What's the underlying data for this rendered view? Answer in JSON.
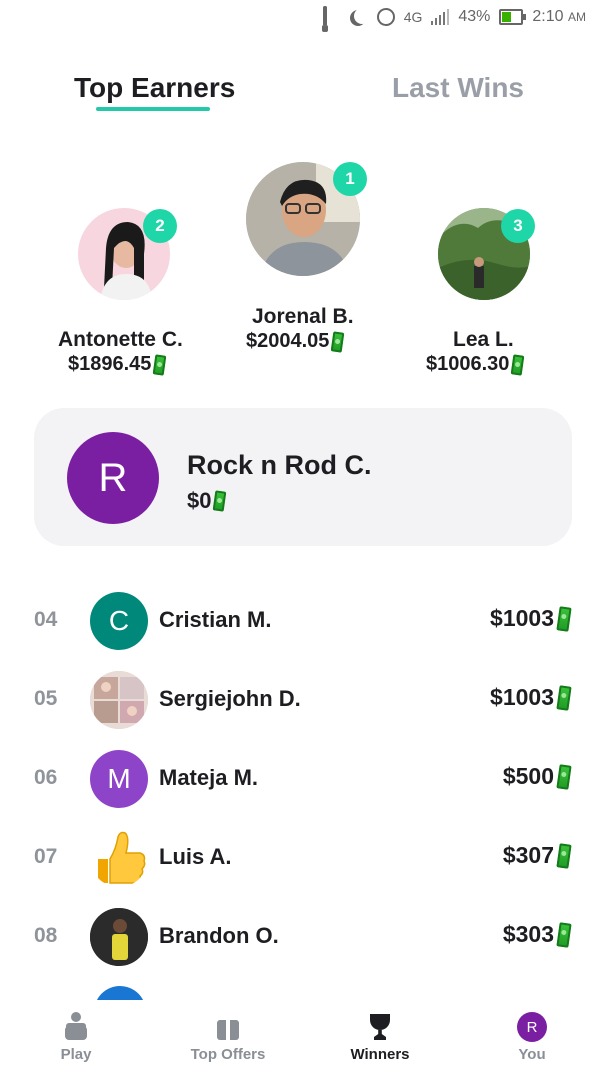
{
  "status_bar": {
    "network": "4G",
    "battery": "43%",
    "battery_level": 0.43,
    "time": "2:10",
    "ampm": "AM"
  },
  "tabs": [
    {
      "label": "Top Earners",
      "active": true
    },
    {
      "label": "Last Wins",
      "active": false
    }
  ],
  "podium": [
    {
      "rank": "2",
      "name": "Antonette C.",
      "amount": "$1896.45"
    },
    {
      "rank": "1",
      "name": "Jorenal B.",
      "amount": "$2004.05"
    },
    {
      "rank": "3",
      "name": "Lea L.",
      "amount": "$1006.30"
    }
  ],
  "me": {
    "initial": "R",
    "name": "Rock n Rod C.",
    "amount": "$0"
  },
  "leaderboard": [
    {
      "rank": "04",
      "initial": "C",
      "name": "Cristian M.",
      "amount": "$1003",
      "avatar_color": "#00897b"
    },
    {
      "rank": "05",
      "initial": "",
      "name": "Sergiejohn D.",
      "amount": "$1003",
      "avatar_color": "#d9c7c0"
    },
    {
      "rank": "06",
      "initial": "M",
      "name": "Mateja M.",
      "amount": "$500",
      "avatar_color": "#8e44c9"
    },
    {
      "rank": "07",
      "initial": "",
      "name": "Luis A.",
      "amount": "$307",
      "avatar_color": "#ffffff"
    },
    {
      "rank": "08",
      "initial": "",
      "name": "Brandon O.",
      "amount": "$303",
      "avatar_color": "#2b2b2b"
    }
  ],
  "nav": {
    "play": "Play",
    "top_offers": "Top Offers",
    "winners": "Winners",
    "you": "You",
    "you_initial": "R"
  },
  "colors": {
    "accent": "#25c8a8",
    "badge": "#1fd6a8",
    "purple": "#7b1fa2",
    "cash_green": "#2fb033"
  }
}
